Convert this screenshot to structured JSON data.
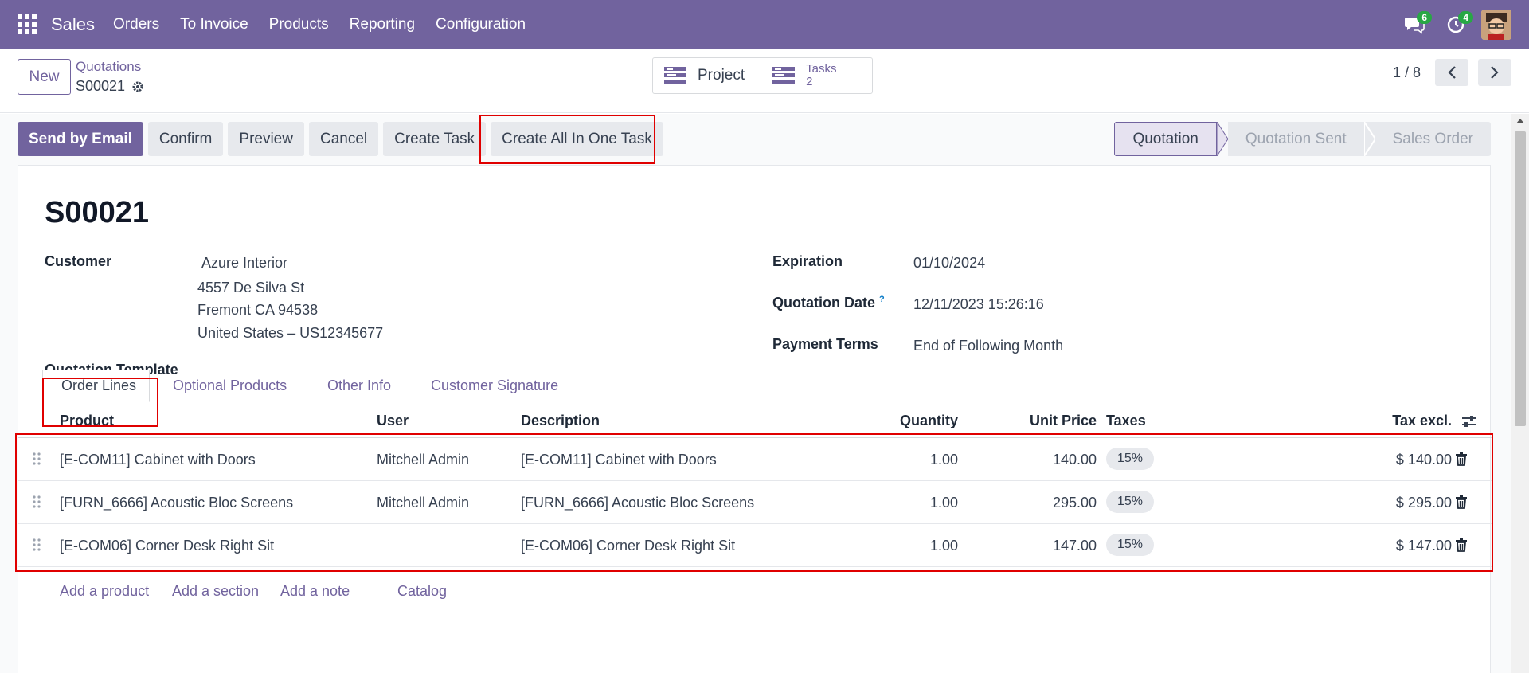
{
  "navbar": {
    "app_name": "Sales",
    "menu": [
      "Orders",
      "To Invoice",
      "Products",
      "Reporting",
      "Configuration"
    ],
    "chat_count": "6",
    "activity_count": "4"
  },
  "control": {
    "new_label": "New",
    "breadcrumb": "Quotations",
    "record_name": "S00021",
    "smart_project_label": "Project",
    "smart_tasks_label": "Tasks",
    "smart_tasks_value": "2",
    "pager": "1 / 8"
  },
  "actions": {
    "send_email": "Send by Email",
    "confirm": "Confirm",
    "preview": "Preview",
    "cancel": "Cancel",
    "create_task": "Create Task",
    "create_all_one": "Create All In One Task"
  },
  "stages": [
    "Quotation",
    "Quotation Sent",
    "Sales Order"
  ],
  "form": {
    "title": "S00021",
    "customer_label": "Customer",
    "customer_name": "Azure Interior",
    "address_1": "4557 De Silva St",
    "address_2": "Fremont CA 94538",
    "address_3": "United States – US12345677",
    "template_label": "Quotation Template",
    "expiration_label": "Expiration",
    "expiration_value": "01/10/2024",
    "quotation_date_label": "Quotation Date",
    "quotation_date_help": "?",
    "quotation_date_value": "12/11/2023 15:26:16",
    "payment_terms_label": "Payment Terms",
    "payment_terms_value": "End of Following Month"
  },
  "tabs": [
    "Order Lines",
    "Optional Products",
    "Other Info",
    "Customer Signature"
  ],
  "table": {
    "headers": [
      "Product",
      "User",
      "Description",
      "Quantity",
      "Unit Price",
      "Taxes",
      "Tax excl."
    ],
    "rows": [
      {
        "product": "[E-COM11] Cabinet with Doors",
        "user": "Mitchell Admin",
        "description": "[E-COM11] Cabinet with Doors",
        "quantity": "1.00",
        "unit_price": "140.00",
        "taxes": "15%",
        "subtotal": "$ 140.00"
      },
      {
        "product": "[FURN_6666] Acoustic Bloc Screens",
        "user": "Mitchell Admin",
        "description": "[FURN_6666] Acoustic Bloc Screens",
        "quantity": "1.00",
        "unit_price": "295.00",
        "taxes": "15%",
        "subtotal": "$ 295.00"
      },
      {
        "product": "[E-COM06] Corner Desk Right Sit",
        "user": "",
        "description": "[E-COM06] Corner Desk Right Sit",
        "quantity": "1.00",
        "unit_price": "147.00",
        "taxes": "15%",
        "subtotal": "$ 147.00"
      }
    ],
    "add_links": [
      "Add a product",
      "Add a section",
      "Add a note",
      "Catalog"
    ]
  },
  "colors": {
    "brand": "#71639e",
    "highlight": "#e00000"
  }
}
